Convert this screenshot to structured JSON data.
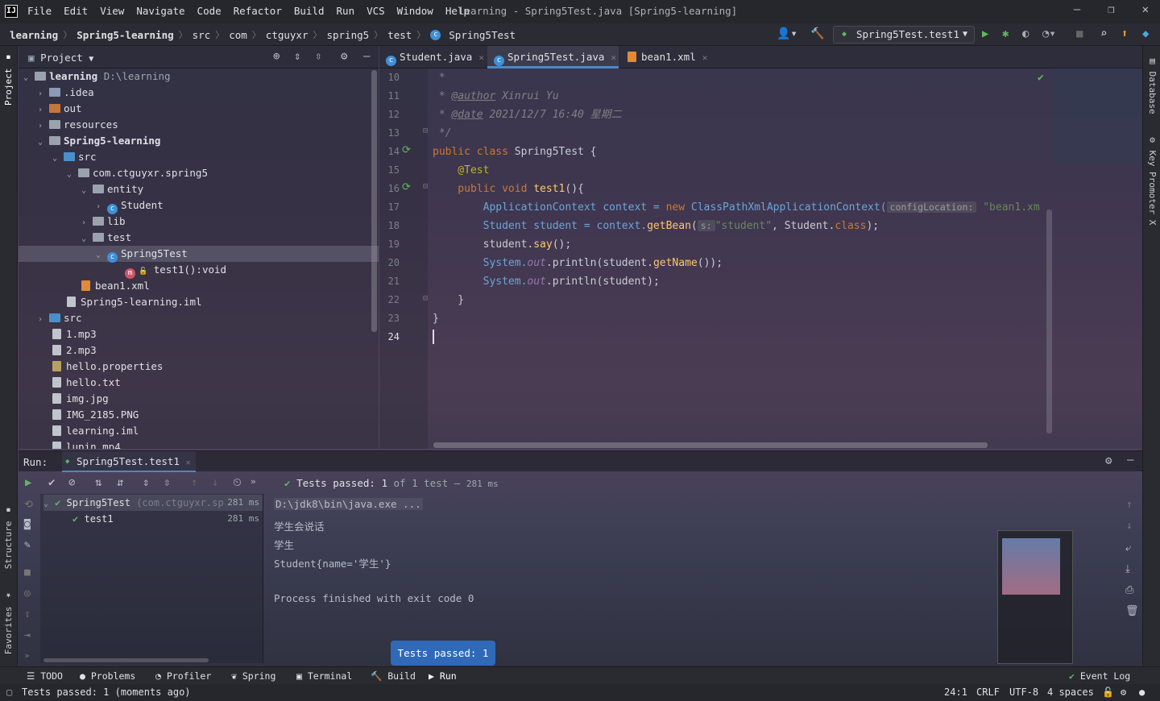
{
  "menu": {
    "items": [
      "File",
      "Edit",
      "View",
      "Navigate",
      "Code",
      "Refactor",
      "Build",
      "Run",
      "VCS",
      "Window",
      "Help"
    ],
    "title": "learning - Spring5Test.java [Spring5-learning]"
  },
  "nav": {
    "crumbs": [
      "learning",
      "Spring5-learning",
      "src",
      "com",
      "ctguyxr",
      "spring5",
      "test",
      "Spring5Test"
    ],
    "run_config": "Spring5Test.test1"
  },
  "stripes": {
    "project": "Project",
    "structure": "Structure",
    "favorites": "Favorites",
    "database": "Database",
    "key_promoter": "Key Promoter X"
  },
  "project": {
    "title": "Project",
    "tree": [
      {
        "label": "learning",
        "extra": "D:\\learning"
      },
      {
        "label": ".idea"
      },
      {
        "label": "out"
      },
      {
        "label": "resources"
      },
      {
        "label": "Spring5-learning"
      },
      {
        "label": "src"
      },
      {
        "label": "com.ctguyxr.spring5"
      },
      {
        "label": "entity"
      },
      {
        "label": "Student"
      },
      {
        "label": "lib"
      },
      {
        "label": "test"
      },
      {
        "label": "Spring5Test"
      },
      {
        "label": "test1():void"
      },
      {
        "label": "bean1.xml"
      },
      {
        "label": "Spring5-learning.iml"
      },
      {
        "label": "src"
      },
      {
        "label": "1.mp3"
      },
      {
        "label": "2.mp3"
      },
      {
        "label": "hello.properties"
      },
      {
        "label": "hello.txt"
      },
      {
        "label": "img.jpg"
      },
      {
        "label": "IMG_2185.PNG"
      },
      {
        "label": "learning.iml"
      },
      {
        "label": "lupin.mp4"
      }
    ]
  },
  "editor": {
    "tabs": [
      {
        "label": "Student.java"
      },
      {
        "label": "Spring5Test.java"
      },
      {
        "label": "bean1.xml"
      }
    ],
    "line_numbers": [
      "10",
      "11",
      "12",
      "13",
      "14",
      "15",
      "16",
      "17",
      "18",
      "19",
      "20",
      "21",
      "22",
      "23",
      "24"
    ],
    "code": {
      "l10": " *",
      "l11a": " * ",
      "l11b": "@author",
      "l11c": " Xinrui Yu",
      "l12a": " * ",
      "l12b": "@date",
      "l12c": " 2021/12/7 16:40 星期二",
      "l13": " */",
      "l14a": "public class ",
      "l14b": "Spring5Test",
      " l14c": " {",
      "l15": "    @Test",
      "l16a": "    public void ",
      "l16b": "test1",
      "l16c": "(){",
      "l17a": "        ApplicationContext context = ",
      "l17b": "new ",
      "l17c": "ClassPathXmlApplicationContext(",
      "l17d": "configLocation:",
      "l17e": "\"bean1.xm",
      "l18a": "        Student student = context.",
      "l18b": "getBean",
      "l18c": "(",
      "l18d": "s:",
      "l18e": "\"student\"",
      "l18f": ", Student.",
      "l18g": "class",
      "l18h": ");",
      "l19a": "        student.",
      "l19b": "say",
      "l19c": "();",
      "l20a": "        System.",
      "l20b": "out",
      "l20c": ".println(student.",
      "l20d": "getName",
      "l20e": "());",
      "l21a": "        System.",
      "l21b": "out",
      "l21c": ".println(student);",
      "l22": "    }",
      "l23": "}"
    }
  },
  "run": {
    "label": "Run:",
    "tab": "Spring5Test.test1",
    "status_prefix": "Tests passed:",
    "status_count": "1",
    "status_suffix": "of 1 test",
    "status_time": "281 ms",
    "tree": [
      {
        "name": "Spring5Test",
        "pkg": "(com.ctguyxr.sp",
        "time": "281 ms"
      },
      {
        "name": "test1",
        "time": "281 ms"
      }
    ],
    "console": [
      "D:\\jdk8\\bin\\java.exe ...",
      "学生会说话",
      "学生",
      "Student{name='学生'}",
      "",
      "Process finished with exit code 0"
    ],
    "tooltip": "Tests passed: 1"
  },
  "bottom": {
    "items": [
      "TODO",
      "Problems",
      "Profiler",
      "Spring",
      "Terminal",
      "Build",
      "Run"
    ],
    "event_log": "Event Log"
  },
  "status": {
    "text": "Tests passed: 1 (moments ago)",
    "position": "24:1",
    "line_sep": "CRLF",
    "encoding": "UTF-8",
    "indent": "4 spaces"
  }
}
